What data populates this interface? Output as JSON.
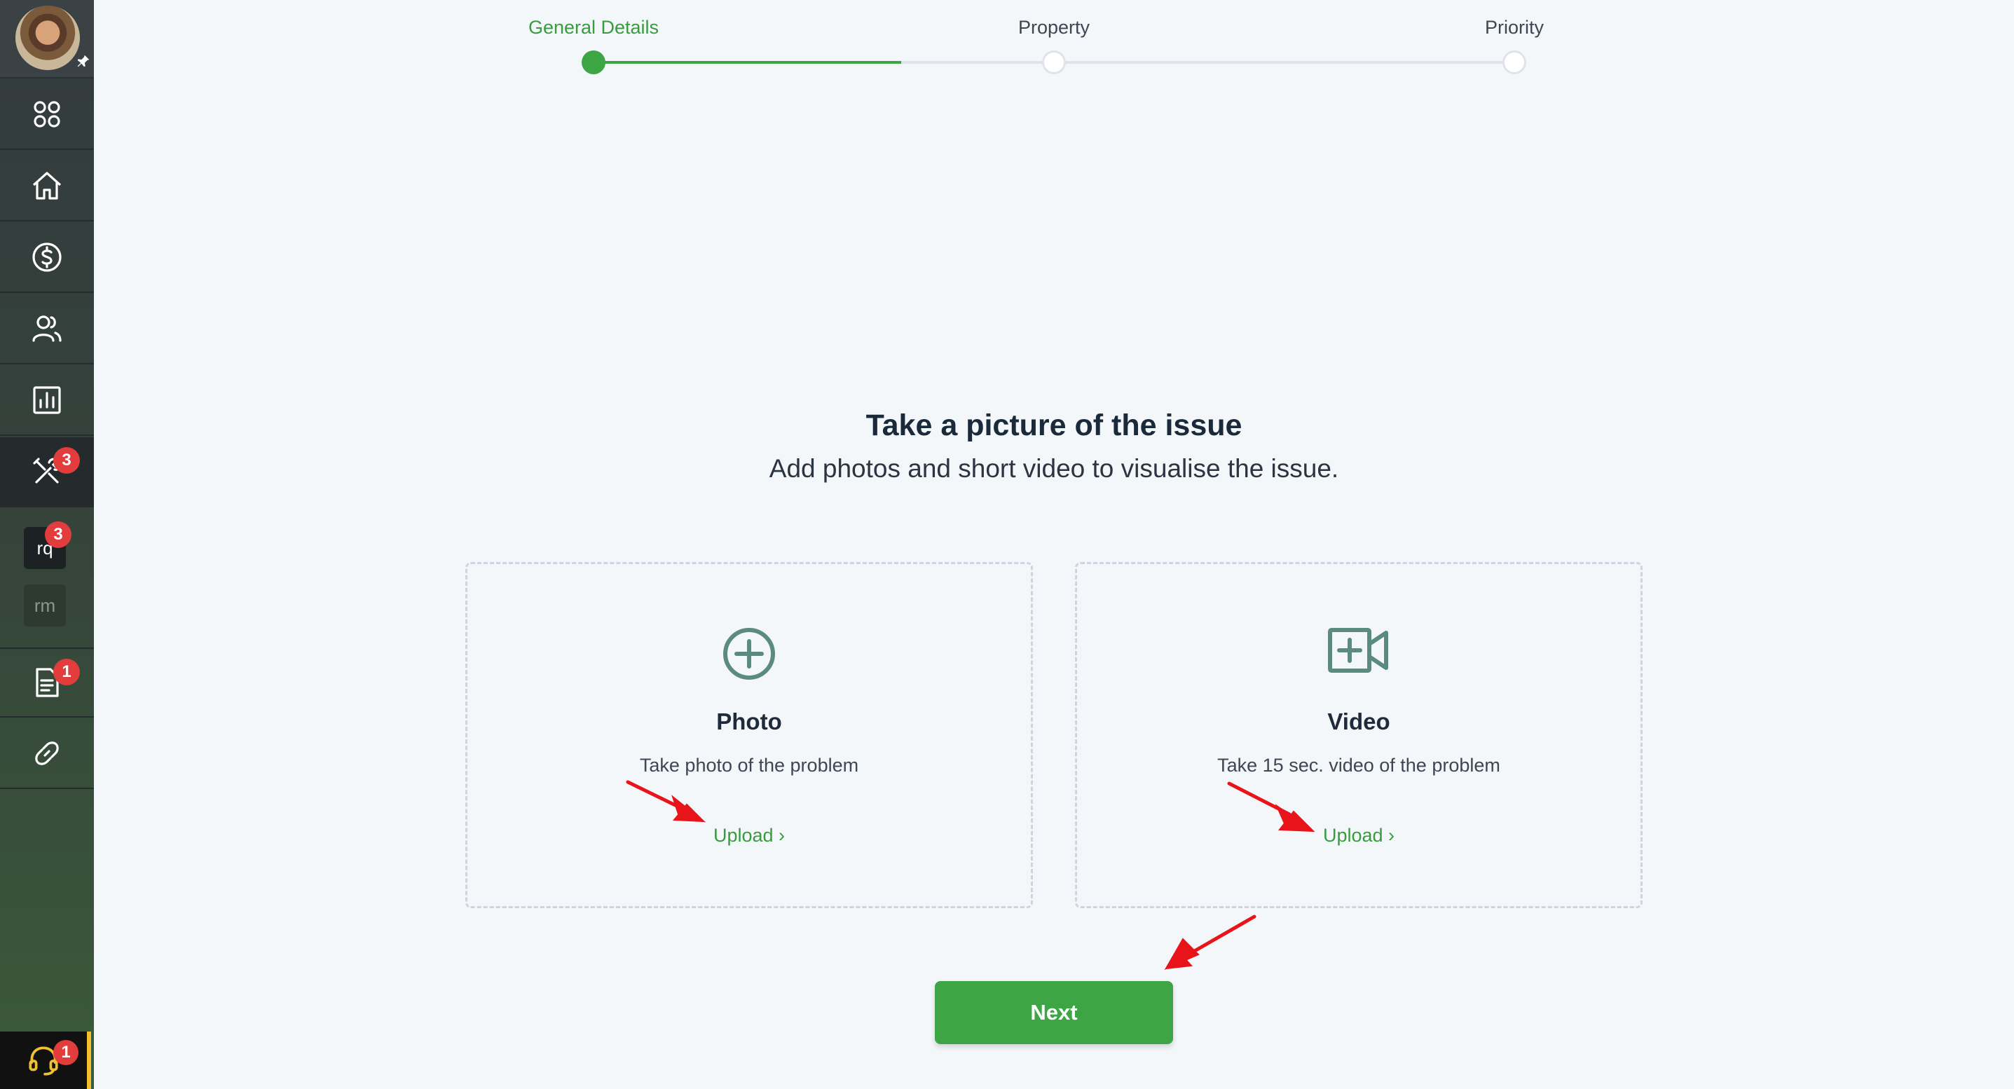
{
  "stepper": {
    "steps": [
      {
        "label": "General Details",
        "state": "done"
      },
      {
        "label": "Property",
        "state": "todo"
      },
      {
        "label": "Priority",
        "state": "todo"
      }
    ]
  },
  "sidebar": {
    "items": [
      {
        "icon": "apps-grid-icon"
      },
      {
        "icon": "home-icon"
      },
      {
        "icon": "dollar-circle-icon"
      },
      {
        "icon": "users-icon"
      },
      {
        "icon": "bar-chart-icon"
      },
      {
        "icon": "tools-icon",
        "badge": "3"
      },
      {
        "icon": "documents-icon",
        "badge": "1"
      },
      {
        "icon": "link-icon"
      }
    ],
    "rq_label": "rq",
    "rq_badge": "3",
    "rm_label": "rm",
    "support_badge": "1"
  },
  "main": {
    "title": "Take a picture of the issue",
    "subtitle": "Add photos and short video to visualise the issue.",
    "cards": [
      {
        "title": "Photo",
        "description": "Take photo of the problem",
        "action": "Upload ›"
      },
      {
        "title": "Video",
        "description": "Take 15 sec. video of the problem",
        "action": "Upload ›"
      }
    ],
    "next_label": "Next"
  },
  "colors": {
    "accent_green": "#3ea545",
    "badge_red": "#e23c3c",
    "icon_teal": "#5a8a80",
    "annotation_red": "#e8141a"
  }
}
